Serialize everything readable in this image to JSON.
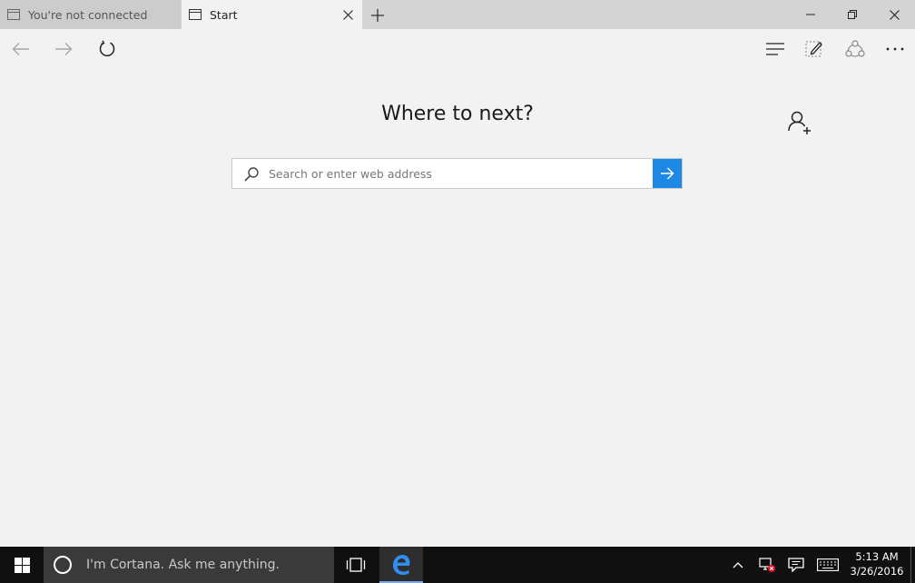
{
  "tabs": [
    {
      "label": "You're not connected"
    },
    {
      "label": "Start"
    }
  ],
  "icons": {
    "tab": "tab-page-icon",
    "close": "close-icon",
    "new_tab": "plus-icon",
    "minimize": "minimize-icon",
    "restore": "restore-icon",
    "window_close": "close-icon",
    "back": "arrow-left-icon",
    "forward": "arrow-right-icon",
    "refresh": "refresh-icon",
    "hub": "hub-icon",
    "web_note": "web-note-icon",
    "share": "share-icon",
    "more": "more-icon",
    "add_person": "add-person-icon",
    "search": "search-icon",
    "go": "arrow-right-icon"
  },
  "start_page": {
    "title": "Where to next?",
    "search_placeholder": "Search or enter web address"
  },
  "taskbar": {
    "cortana_placeholder": "I'm Cortana. Ask me anything.",
    "time": "5:13 AM",
    "date": "3/26/2016"
  },
  "colors": {
    "accent": "#1e88e5",
    "taskbar": "#101010",
    "page_background": "#f2f2f2"
  }
}
